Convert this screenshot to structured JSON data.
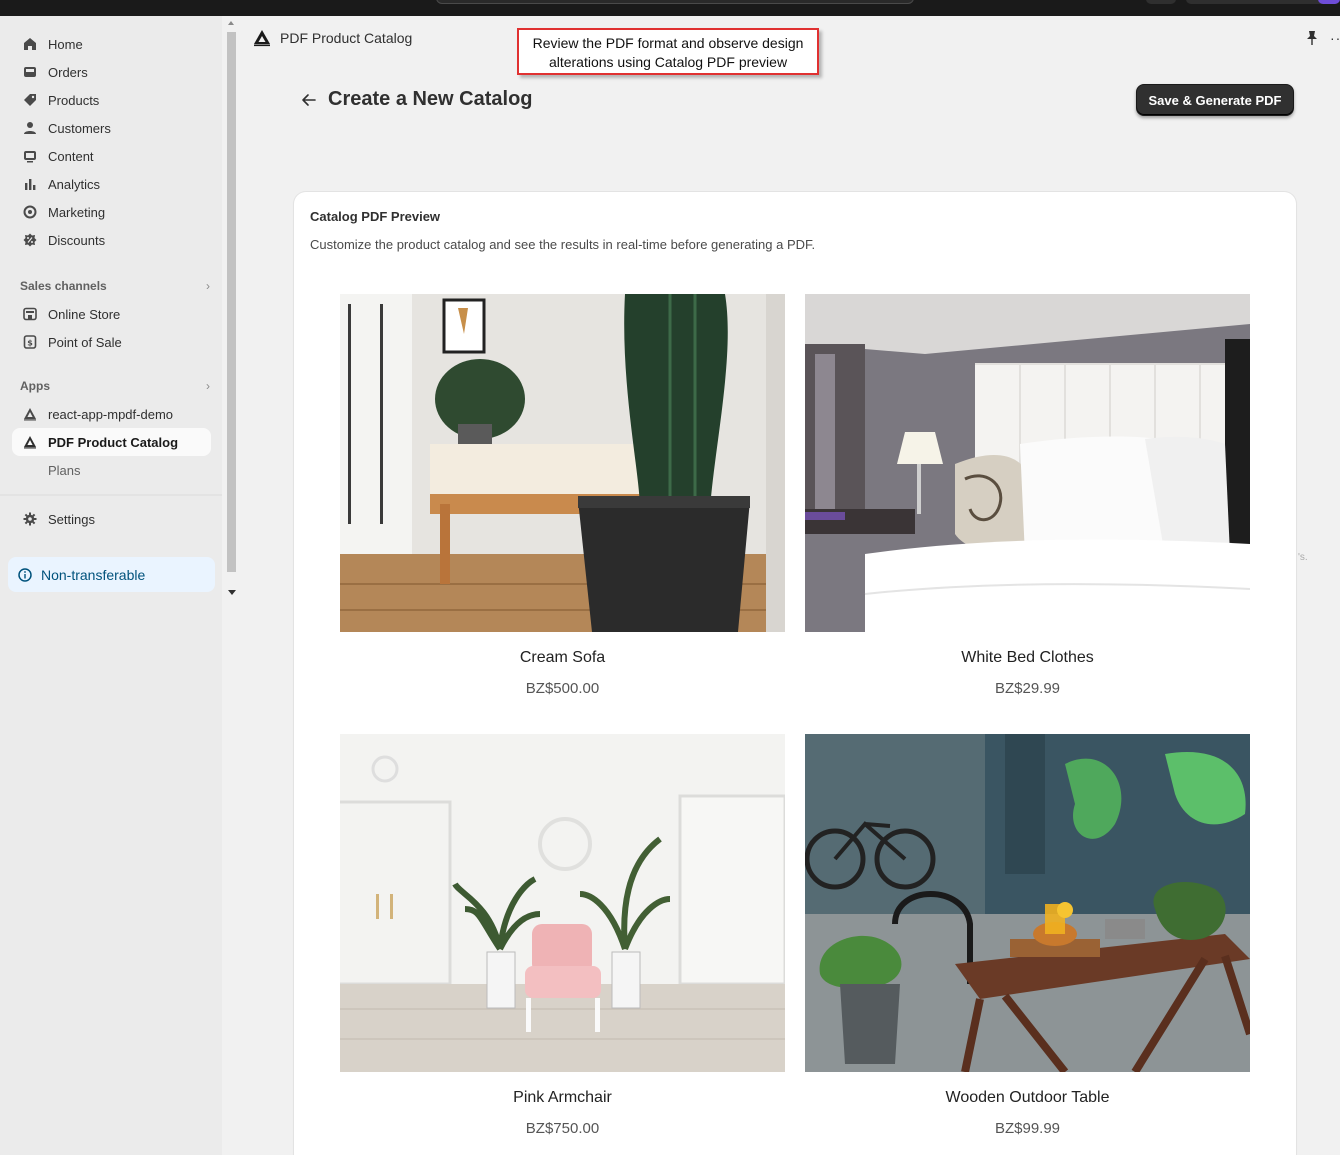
{
  "sidebar": {
    "items": [
      {
        "label": "Home",
        "icon": "home-icon"
      },
      {
        "label": "Orders",
        "icon": "inbox-icon"
      },
      {
        "label": "Products",
        "icon": "tag-icon"
      },
      {
        "label": "Customers",
        "icon": "person-icon"
      },
      {
        "label": "Content",
        "icon": "image-icon"
      },
      {
        "label": "Analytics",
        "icon": "bar-chart-icon"
      },
      {
        "label": "Marketing",
        "icon": "target-icon"
      },
      {
        "label": "Discounts",
        "icon": "discount-icon"
      }
    ],
    "sales_channels": {
      "heading": "Sales channels",
      "items": [
        {
          "label": "Online Store",
          "icon": "store-icon"
        },
        {
          "label": "Point of Sale",
          "icon": "pos-icon"
        }
      ]
    },
    "apps": {
      "heading": "Apps",
      "items": [
        {
          "label": "react-app-mpdf-demo",
          "icon": "app-logo-icon"
        },
        {
          "label": "PDF Product Catalog",
          "icon": "app-logo-icon",
          "active": true
        },
        {
          "label": "Plans"
        }
      ]
    },
    "settings_label": "Settings",
    "badge_label": "Non-transferable"
  },
  "app_header": {
    "title": "PDF Product Catalog"
  },
  "callout": {
    "line1": "Review the PDF format and observe design",
    "line2": "alterations using Catalog PDF preview"
  },
  "page": {
    "title": "Create a New Catalog",
    "primary_action": "Save & Generate PDF"
  },
  "preview": {
    "title": "Catalog PDF Preview",
    "description": "Customize the product catalog and see the results in real-time before generating a PDF.",
    "products": [
      {
        "name": "Cream Sofa",
        "price": "BZ$500.00"
      },
      {
        "name": "White Bed Clothes",
        "price": "BZ$29.99"
      },
      {
        "name": "Pink Armchair",
        "price": "BZ$750.00"
      },
      {
        "name": "Wooden Outdoor Table",
        "price": "BZ$99.99"
      }
    ]
  },
  "stray_text": "'s.",
  "colors": {
    "primary_button": "#303030",
    "callout_border": "#e03131",
    "badge_bg": "#eaf4ff",
    "badge_text": "#00527c",
    "sidebar_bg": "#ebebeb",
    "page_bg": "#f1f1f1"
  }
}
